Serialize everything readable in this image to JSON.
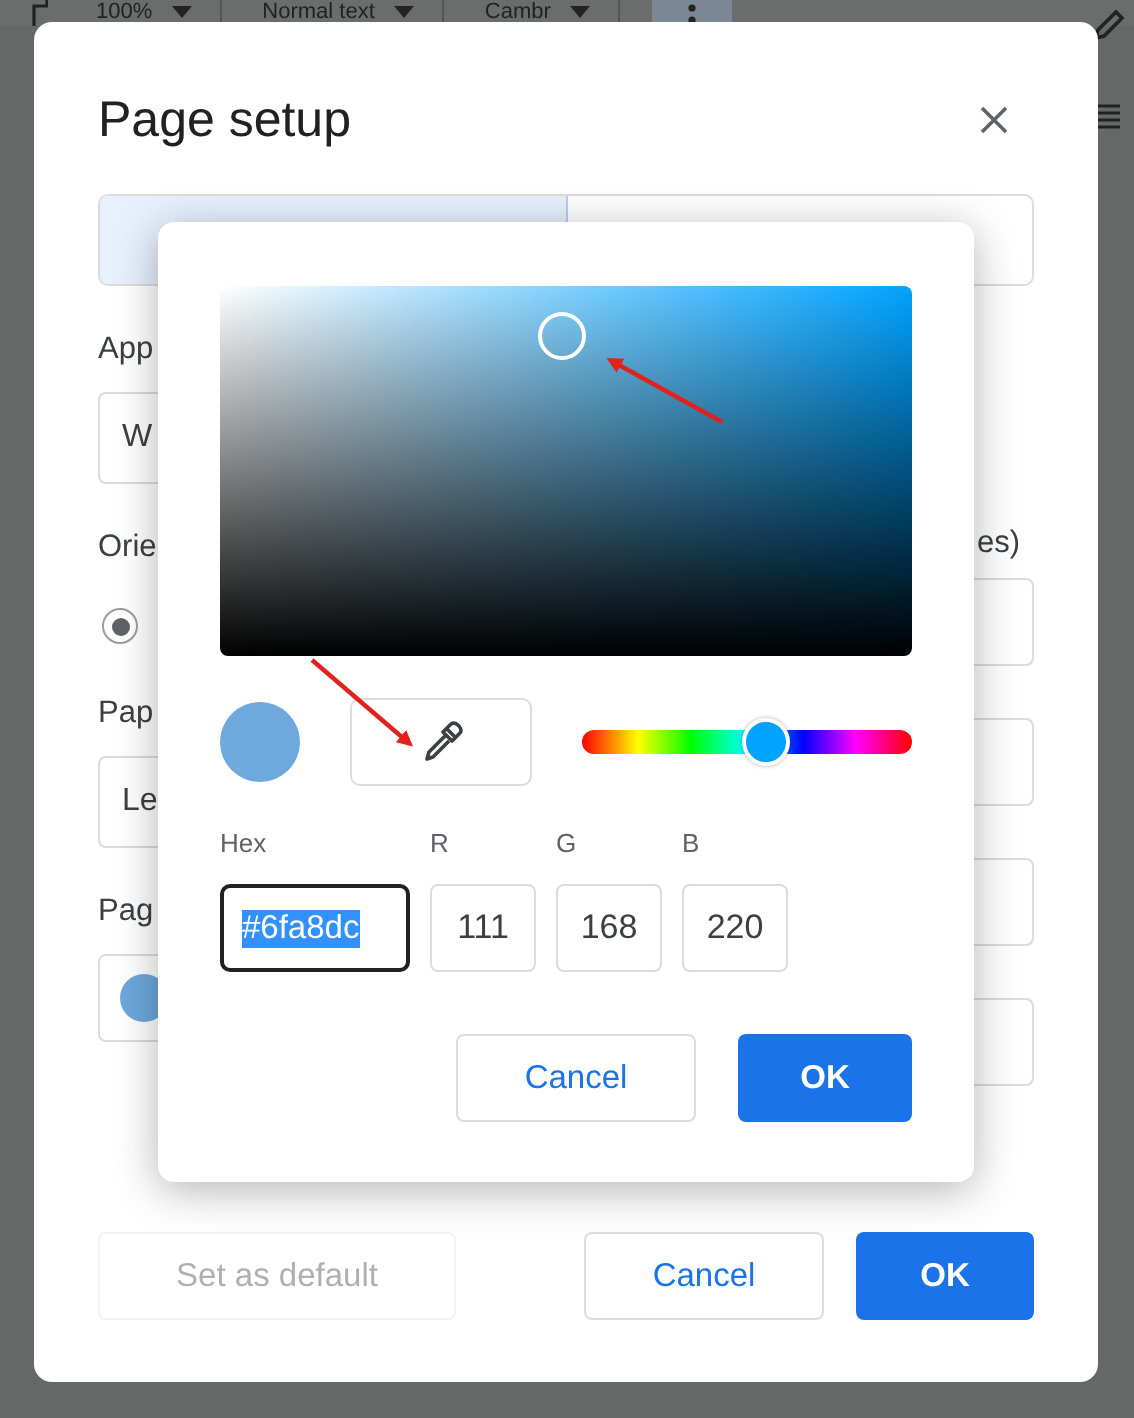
{
  "toolbar": {
    "zoom": "100%",
    "style": "Normal text",
    "font": "Cambr",
    "more_button": {
      "selected": true
    }
  },
  "dialog": {
    "title": "Page setup",
    "tabs": [
      {
        "selected": true
      },
      {
        "selected": false
      }
    ],
    "left_labels": [
      "App",
      "Orie",
      "Pap",
      "Pag"
    ],
    "apply_field": {
      "value": "W"
    },
    "orientation_options": [
      {
        "selected": true
      }
    ],
    "paper_field": {
      "value": "Le"
    },
    "page_color": {
      "color": "#6fa8dc"
    },
    "right_label": "es)",
    "buttons": [
      {
        "label": "Set as default",
        "kind": "plain",
        "disabled": true
      },
      {
        "label": "Cancel",
        "kind": "outline",
        "disabled": false
      },
      {
        "label": "OK",
        "kind": "primary",
        "disabled": false
      }
    ]
  },
  "color_picker": {
    "hue_slider": {
      "level": 0.56
    },
    "hex_label": "Hex",
    "hex": {
      "value": "#6fa8dc",
      "text_selected": true
    },
    "channels": [
      {
        "label": "R",
        "value": "111"
      },
      {
        "label": "G",
        "value": "168"
      },
      {
        "label": "B",
        "value": "220"
      }
    ],
    "buttons": [
      {
        "label": "Cancel",
        "kind": "outline"
      },
      {
        "label": "OK",
        "kind": "primary"
      }
    ]
  }
}
